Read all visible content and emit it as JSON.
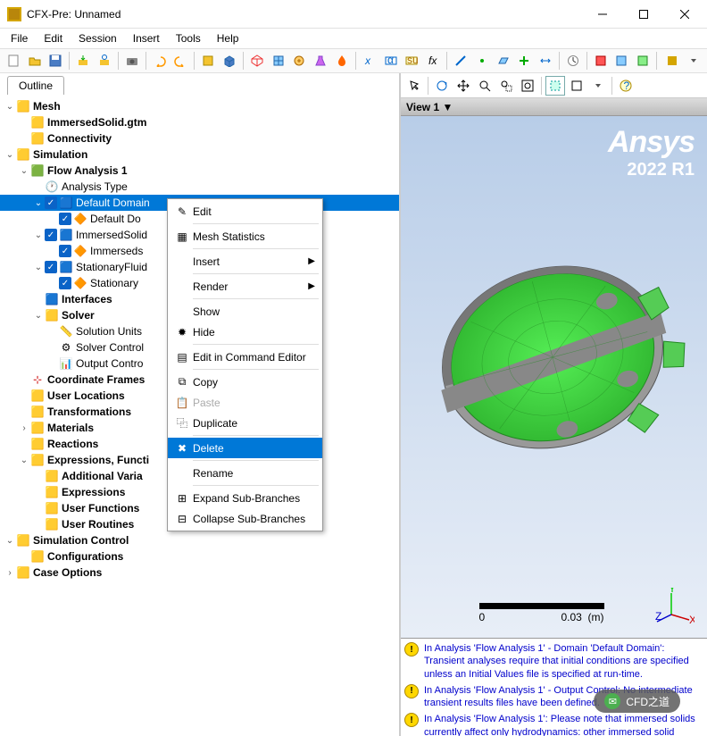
{
  "window": {
    "title": "CFX-Pre: Unnamed"
  },
  "menu": {
    "file": "File",
    "edit": "Edit",
    "session": "Session",
    "insert": "Insert",
    "tools": "Tools",
    "help": "Help"
  },
  "outline_tab": "Outline",
  "tree": {
    "mesh": "Mesh",
    "mesh_file": "ImmersedSolid.gtm",
    "connectivity": "Connectivity",
    "simulation": "Simulation",
    "flow": "Flow Analysis 1",
    "analysis_type": "Analysis Type",
    "default_domain": "Default Domain",
    "default_domain_default": "Default Do",
    "immersedsolid": "ImmersedSolid",
    "immerseds": "Immerseds",
    "stationaryfluid": "StationaryFluid",
    "stationary": "Stationary",
    "interfaces": "Interfaces",
    "solver": "Solver",
    "solution_units": "Solution Units",
    "solver_control": "Solver Control",
    "output_control": "Output Contro",
    "coord_frames": "Coordinate Frames",
    "user_locations": "User Locations",
    "transformations": "Transformations",
    "materials": "Materials",
    "reactions": "Reactions",
    "expressions": "Expressions, Functi",
    "additional_vars": "Additional Varia",
    "expressions2": "Expressions",
    "user_functions": "User Functions",
    "user_routines": "User Routines",
    "sim_control": "Simulation Control",
    "configurations": "Configurations",
    "case_options": "Case Options"
  },
  "context_menu": {
    "edit": "Edit",
    "mesh_stats": "Mesh Statistics",
    "insert": "Insert",
    "render": "Render",
    "show": "Show",
    "hide": "Hide",
    "edit_cmd": "Edit in Command Editor",
    "copy": "Copy",
    "paste": "Paste",
    "duplicate": "Duplicate",
    "delete": "Delete",
    "rename": "Rename",
    "expand": "Expand Sub-Branches",
    "collapse": "Collapse Sub-Branches"
  },
  "view": {
    "header": "View 1 ▼"
  },
  "logo": {
    "brand": "Ansys",
    "version": "2022 R1"
  },
  "scale": {
    "zero": "0",
    "mid": "0.03",
    "unit": "(m)"
  },
  "messages": [
    "In Analysis 'Flow Analysis 1' - Domain 'Default Domain': Transient analyses require that initial conditions are specified unless an Initial Values file is specified at run-time.",
    "In Analysis 'Flow Analysis 1' - Output Control: No intermediate transient results files have been defined.",
    "In Analysis 'Flow Analysis 1': Please note that immersed solids currently affect only hydrodynamics: other immersed solid"
  ],
  "watermark": "CFD之道"
}
